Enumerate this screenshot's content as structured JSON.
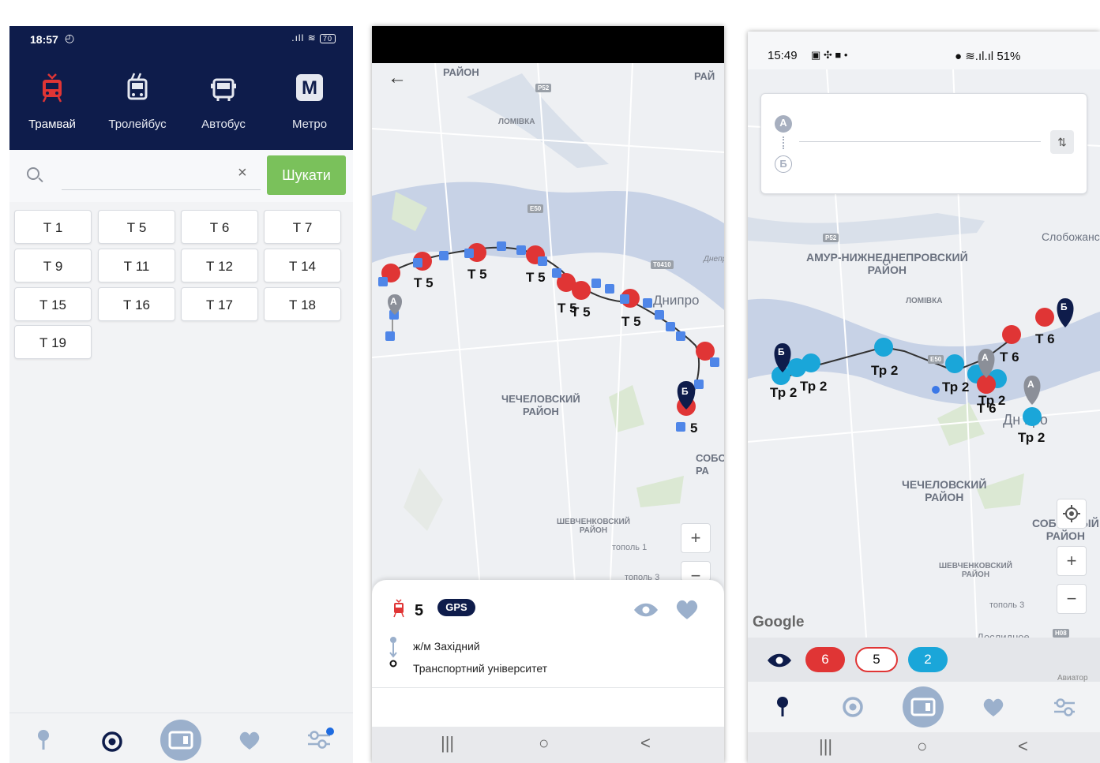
{
  "phone1": {
    "status": {
      "time": "18:57",
      "alarm_icon": "alarm-icon",
      "battery": "70",
      "signal_icon": "signal-icon",
      "wifi_icon": "wifi-icon"
    },
    "tabs": [
      {
        "label": "Трамвай",
        "icon": "tram-icon",
        "active": true
      },
      {
        "label": "Тролейбус",
        "icon": "trolleybus-icon",
        "active": false
      },
      {
        "label": "Автобус",
        "icon": "bus-icon",
        "active": false
      },
      {
        "label": "Метро",
        "icon": "metro-icon",
        "active": false
      }
    ],
    "metro_glyph": "M",
    "search": {
      "placeholder": "",
      "clear_glyph": "×",
      "button_label": "Шукати"
    },
    "routes": [
      "Т 1",
      "Т 5",
      "Т 6",
      "Т 7",
      "Т 9",
      "Т 11",
      "Т 12",
      "Т 14",
      "Т 15",
      "Т 16",
      "Т 17",
      "Т 18",
      "Т 19"
    ],
    "nav": [
      "pin-icon",
      "target-icon",
      "transport-card-icon",
      "heart-icon",
      "filter-icon"
    ]
  },
  "phone2": {
    "back_glyph": "←",
    "map_labels": {
      "district_top": "РАЙОН",
      "district_top_right": "РАЙ",
      "lomivka": "ЛОМІВКА",
      "dnipro": "Днипро",
      "chechelivskyi": "ЧЕЧЕЛОВСКИЙ\nРАЙОН",
      "shevchenkivskyi": "ШЕВЧЕНКОВСКИЙ\nРАЙОН",
      "topol1": "тополь 1",
      "topol3": "тополь 3",
      "sobor": "СОБО\nРА",
      "road_p52": "P52",
      "road_e50": "E50",
      "road_t0410": "T0410",
      "river": "Днепр"
    },
    "vehicle_labels": [
      "Т 5",
      "Т 5",
      "Т 5",
      "Т 5",
      "Т 5",
      "Т 5",
      "5"
    ],
    "markers": {
      "a": "А",
      "b": "Б"
    },
    "zoom": {
      "plus": "+",
      "minus": "−"
    },
    "sheet": {
      "route_number": "5",
      "gps_badge": "GPS",
      "from_stop": "ж/м Західний",
      "to_stop": "Транспортний університет"
    },
    "sysnav": {
      "recent": "|||",
      "home": "○",
      "back": "<"
    }
  },
  "phone3": {
    "status": {
      "time": "15:49",
      "battery": "51%"
    },
    "route_box": {
      "a": "А",
      "b": "Б",
      "swap_glyph": "⇅"
    },
    "map_labels": {
      "slobozhansk": "Слобожанс",
      "amur": "АМУР-НИЖНЕДНЕПРОВСКИЙ\nРАЙОН",
      "lomivka": "ЛОМІВКА",
      "chechelivskyi": "ЧЕЧЕЛОВСКИЙ\nРАЙОН",
      "sobornyi": "СОБОРНЫЙ\nРАЙОН",
      "shevchenkivskyi": "ШЕВЧЕНКОВСКИЙ\nРАЙОН",
      "topol3": "тополь 3",
      "doslidnoe": "Дослидное",
      "dnipro": "Дн  про",
      "road_p52": "P52",
      "road_e50": "E50",
      "road_h08": "H08",
      "google": "Google",
      "avuator": "Авиатор"
    },
    "vehicle_labels": [
      "Тр 2",
      "Тр 2",
      "Тр 2",
      "Тр 2",
      "Тр 2",
      "Тр 2",
      "Т 6",
      "Т 6",
      "Т 6"
    ],
    "markers": {
      "a": "А",
      "b": "Б"
    },
    "zoom": {
      "plus": "+",
      "minus": "−"
    },
    "filter": {
      "tram_count": "6",
      "bus_count": "5",
      "trolley_count": "2"
    },
    "sysnav": {
      "recent": "|||",
      "home": "○",
      "back": "<"
    }
  },
  "colors": {
    "navy": "#0e1c4b",
    "tram_red": "#e03535",
    "trolley_blue": "#1aa6d9",
    "bus_blue": "#4f86e8",
    "search_green": "#7ac15b"
  }
}
